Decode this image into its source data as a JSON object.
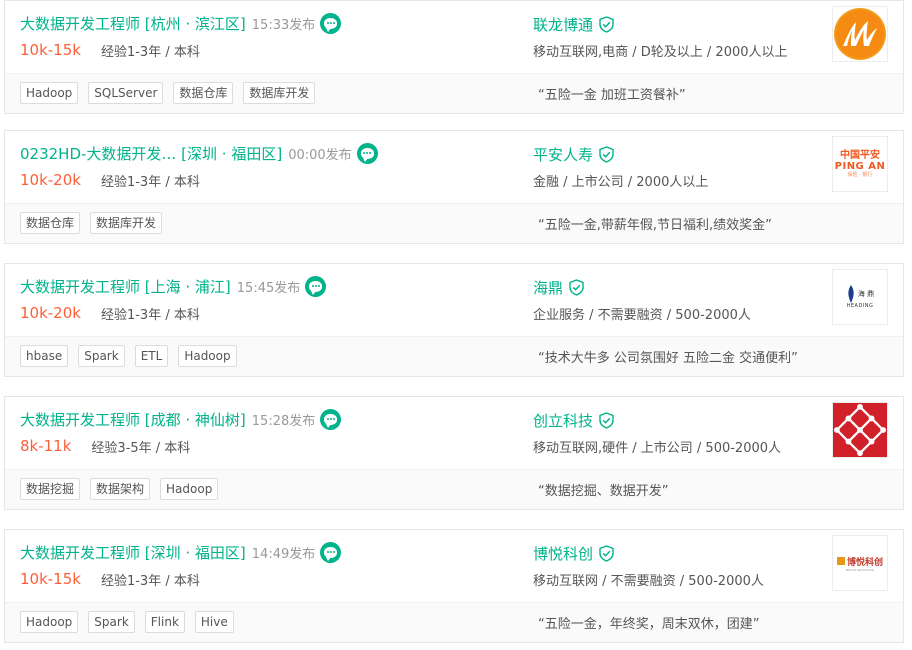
{
  "colors": {
    "accent": "#00b38a",
    "salary": "#fd5f39",
    "muted": "#999999"
  },
  "jobs": [
    {
      "title": "大数据开发工程师 [杭州 · 滨江区]",
      "pubtime": "15:33发布",
      "salary": "10k-15k",
      "requirement": "经验1-3年 / 本科",
      "company": "联龙博通",
      "industry": "移动互联网,电商 / D轮及以上 / 2000人以上",
      "tags": [
        "Hadoop",
        "SQLServer",
        "数据仓库",
        "数据库开发"
      ],
      "benefit": "“五险一金 加班工资餐补”"
    },
    {
      "title": "0232HD-大数据开发…   [深圳 · 福田区]",
      "pubtime": "00:00发布",
      "salary": "10k-20k",
      "requirement": "经验1-3年 / 本科",
      "company": "平安人寿",
      "industry": "金融 / 上市公司 / 2000人以上",
      "tags": [
        "数据仓库",
        "数据库开发"
      ],
      "benefit": "“五险一金,带薪年假,节日福利,绩效奖金”",
      "logo_text_1": "中国平安",
      "logo_text_2": "PING AN",
      "logo_text_3": "保险 · 银行"
    },
    {
      "title": "大数据开发工程师 [上海 · 浦江]",
      "pubtime": "15:45发布",
      "salary": "10k-20k",
      "requirement": "经验1-3年 / 本科",
      "company": "海鼎",
      "industry": "企业服务 / 不需要融资 / 500-2000人",
      "tags": [
        "hbase",
        "Spark",
        "ETL",
        "Hadoop"
      ],
      "benefit": "“技术大牛多 公司氛围好 五险二金 交通便利”",
      "logo_text_1": "海  鼎",
      "logo_text_2": "HEADING"
    },
    {
      "title": "大数据开发工程师 [成都 · 神仙树]",
      "pubtime": "15:28发布",
      "salary": "8k-11k",
      "requirement": "经验3-5年 / 本科",
      "company": "创立科技",
      "industry": "移动互联网,硬件 / 上市公司 / 500-2000人",
      "tags": [
        "数据挖掘",
        "数据架构",
        "Hadoop"
      ],
      "benefit": "“数据挖掘、数据开发”"
    },
    {
      "title": "大数据开发工程师 [深圳 · 福田区]",
      "pubtime": "14:49发布",
      "salary": "10k-15k",
      "requirement": "经验1-3年 / 本科",
      "company": "博悦科创",
      "industry": "移动互联网 / 不需要融资 / 500-2000人",
      "tags": [
        "Hadoop",
        "Spark",
        "Flink",
        "Hive"
      ],
      "benefit": "“五险一金，年终奖，周末双休，团建”",
      "logo_text_1": "博悦科创",
      "logo_text_2": "BOYUE KECHUANG"
    }
  ]
}
